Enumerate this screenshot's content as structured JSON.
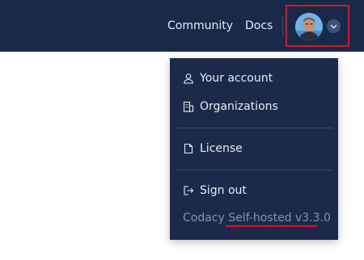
{
  "header": {
    "nav": [
      {
        "label": "Community"
      },
      {
        "label": "Docs"
      }
    ],
    "avatar_icon": "user-avatar",
    "dropdown_icon": "chevron-down-icon",
    "highlight_color": "#e3131c"
  },
  "menu": {
    "items": [
      {
        "label": "Your account",
        "icon": "user-icon"
      },
      {
        "label": "Organizations",
        "icon": "building-icon"
      },
      {
        "label": "License",
        "icon": "document-icon"
      },
      {
        "label": "Sign out",
        "icon": "sign-out-icon"
      }
    ],
    "version": "Codacy Self-hosted v3.3.0"
  },
  "colors": {
    "header_bg": "#19294a",
    "menu_bg": "#1b2a4b",
    "text": "#e8ecf4",
    "muted": "#8593ad"
  }
}
